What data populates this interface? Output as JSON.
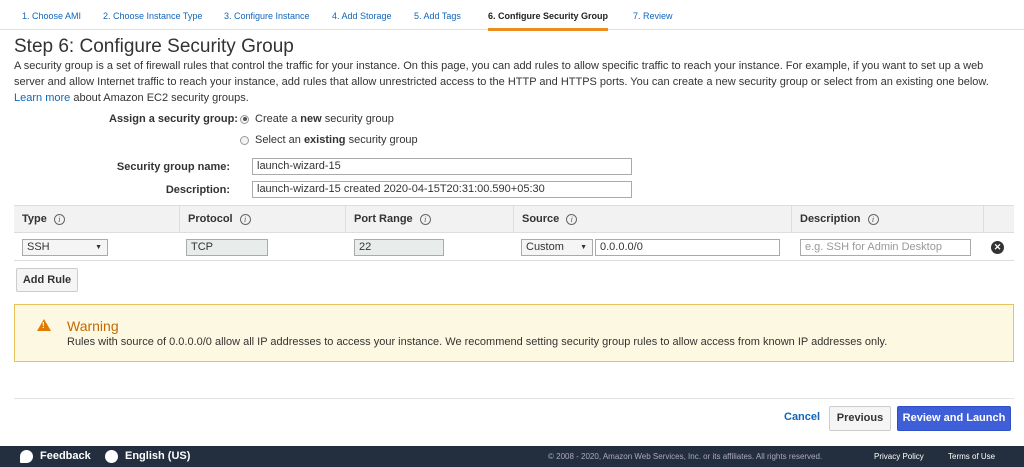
{
  "steps": [
    {
      "label": "1. Choose AMI"
    },
    {
      "label": "2. Choose Instance Type"
    },
    {
      "label": "3. Configure Instance"
    },
    {
      "label": "4. Add Storage"
    },
    {
      "label": "5. Add Tags"
    },
    {
      "label": "6. Configure Security Group",
      "active": true
    },
    {
      "label": "7. Review"
    }
  ],
  "page": {
    "title": "Step 6: Configure Security Group",
    "intro": "A security group is a set of firewall rules that control the traffic for your instance. On this page, you can add rules to allow specific traffic to reach your instance. For example, if you want to set up a web server and allow Internet traffic to reach your instance, add rules that allow unrestricted access to the HTTP and HTTPS ports. You can create a new security group or select from an existing one below.",
    "learn_more": "Learn more",
    "intro_tail": "about Amazon EC2 security groups."
  },
  "assign": {
    "label": "Assign a security group:",
    "option_new_pre": "Create a",
    "option_new_bold": "new",
    "option_new_post": "security group",
    "option_existing_pre": "Select an",
    "option_existing_bold": "existing",
    "option_existing_post": "security group",
    "selected": "new"
  },
  "form": {
    "name_label": "Security group name:",
    "name_value": "launch-wizard-15",
    "desc_label": "Description:",
    "desc_value": "launch-wizard-15 created 2020-04-15T20:31:00.590+05:30"
  },
  "rules": {
    "columns": [
      "Type",
      "Protocol",
      "Port Range",
      "Source",
      "Description"
    ],
    "row": {
      "type": "SSH",
      "protocol": "TCP",
      "port_range": "22",
      "source_mode": "Custom",
      "source_value": "0.0.0.0/0",
      "description_placeholder": "e.g. SSH for Admin Desktop"
    },
    "add_rule": "Add Rule"
  },
  "warning": {
    "title": "Warning",
    "text": "Rules with source of 0.0.0.0/0 allow all IP addresses to access your instance. We recommend setting security group rules to allow access from known IP addresses only."
  },
  "actions": {
    "cancel": "Cancel",
    "previous": "Previous",
    "review_launch": "Review and Launch"
  },
  "footer": {
    "feedback": "Feedback",
    "language": "English (US)",
    "copyright": "© 2008 - 2020, Amazon Web Services, Inc. or its affiliates. All rights reserved.",
    "privacy": "Privacy Policy",
    "terms": "Terms of Use"
  },
  "colors": {
    "link": "#1166bb",
    "active_step_underline": "#eb8c1c",
    "primary_button": "#3f5fd8",
    "warning_bg": "#fdf8e2",
    "warning_title": "#c66a00",
    "footer_bg": "#232f3e"
  }
}
